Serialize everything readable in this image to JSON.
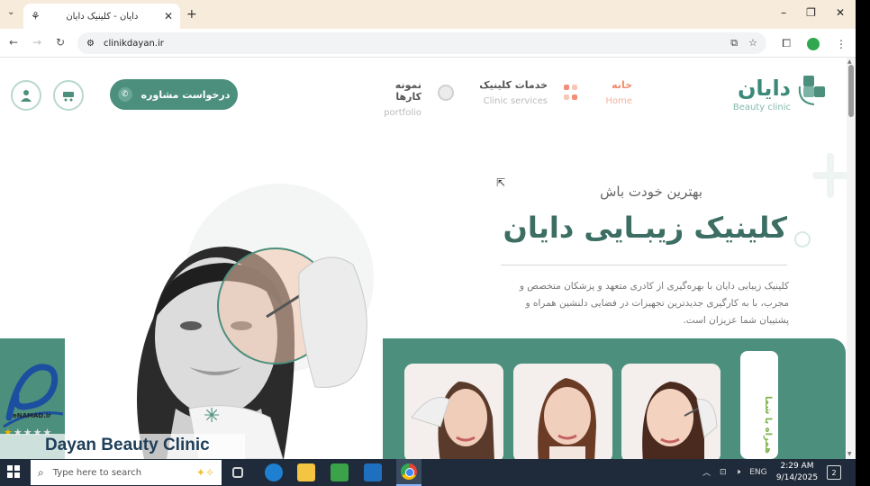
{
  "browser": {
    "tab_title": "دایان - کلینیک دایان",
    "url": "clinikdayan.ir",
    "min": "–",
    "max": "❐",
    "close": "✕"
  },
  "site": {
    "logo_text": "دایان",
    "logo_sub": "Beauty clinic",
    "nav": [
      {
        "fa": "خانه",
        "en": "Home"
      },
      {
        "fa": "خدمات کلینیک",
        "en": "Clinic services"
      },
      {
        "fa": "نمونه کارها",
        "en": "portfolio"
      }
    ],
    "cta_label": "درخواست مشاوره"
  },
  "hero": {
    "tagline": "بهترین خودت باش",
    "title": "کلینیک زیبـایی دایان",
    "description": "کلینیک زیبایی دایان با بهره‌گیری از کادری متعهد و پزشکان متخصص و مجرب، با به کارگیری جدیدترین تجهیزات در فضایی دلنشین همراه و پشتیبان شما عزیزان است.",
    "side_card_text": "همراه با شما"
  },
  "enamad": {
    "label": "eNAMAD.ir",
    "stars": 1,
    "stars_total": 5
  },
  "overlay": {
    "caption": "Dayan Beauty Clinic"
  },
  "taskbar": {
    "search_placeholder": "Type here to search",
    "tray_lang": "ENG",
    "time": "2:29 AM",
    "date": "9/14/2025",
    "notify_count": "2"
  },
  "colors": {
    "brand": "#4c8f7d",
    "accent": "#f08a6a"
  }
}
